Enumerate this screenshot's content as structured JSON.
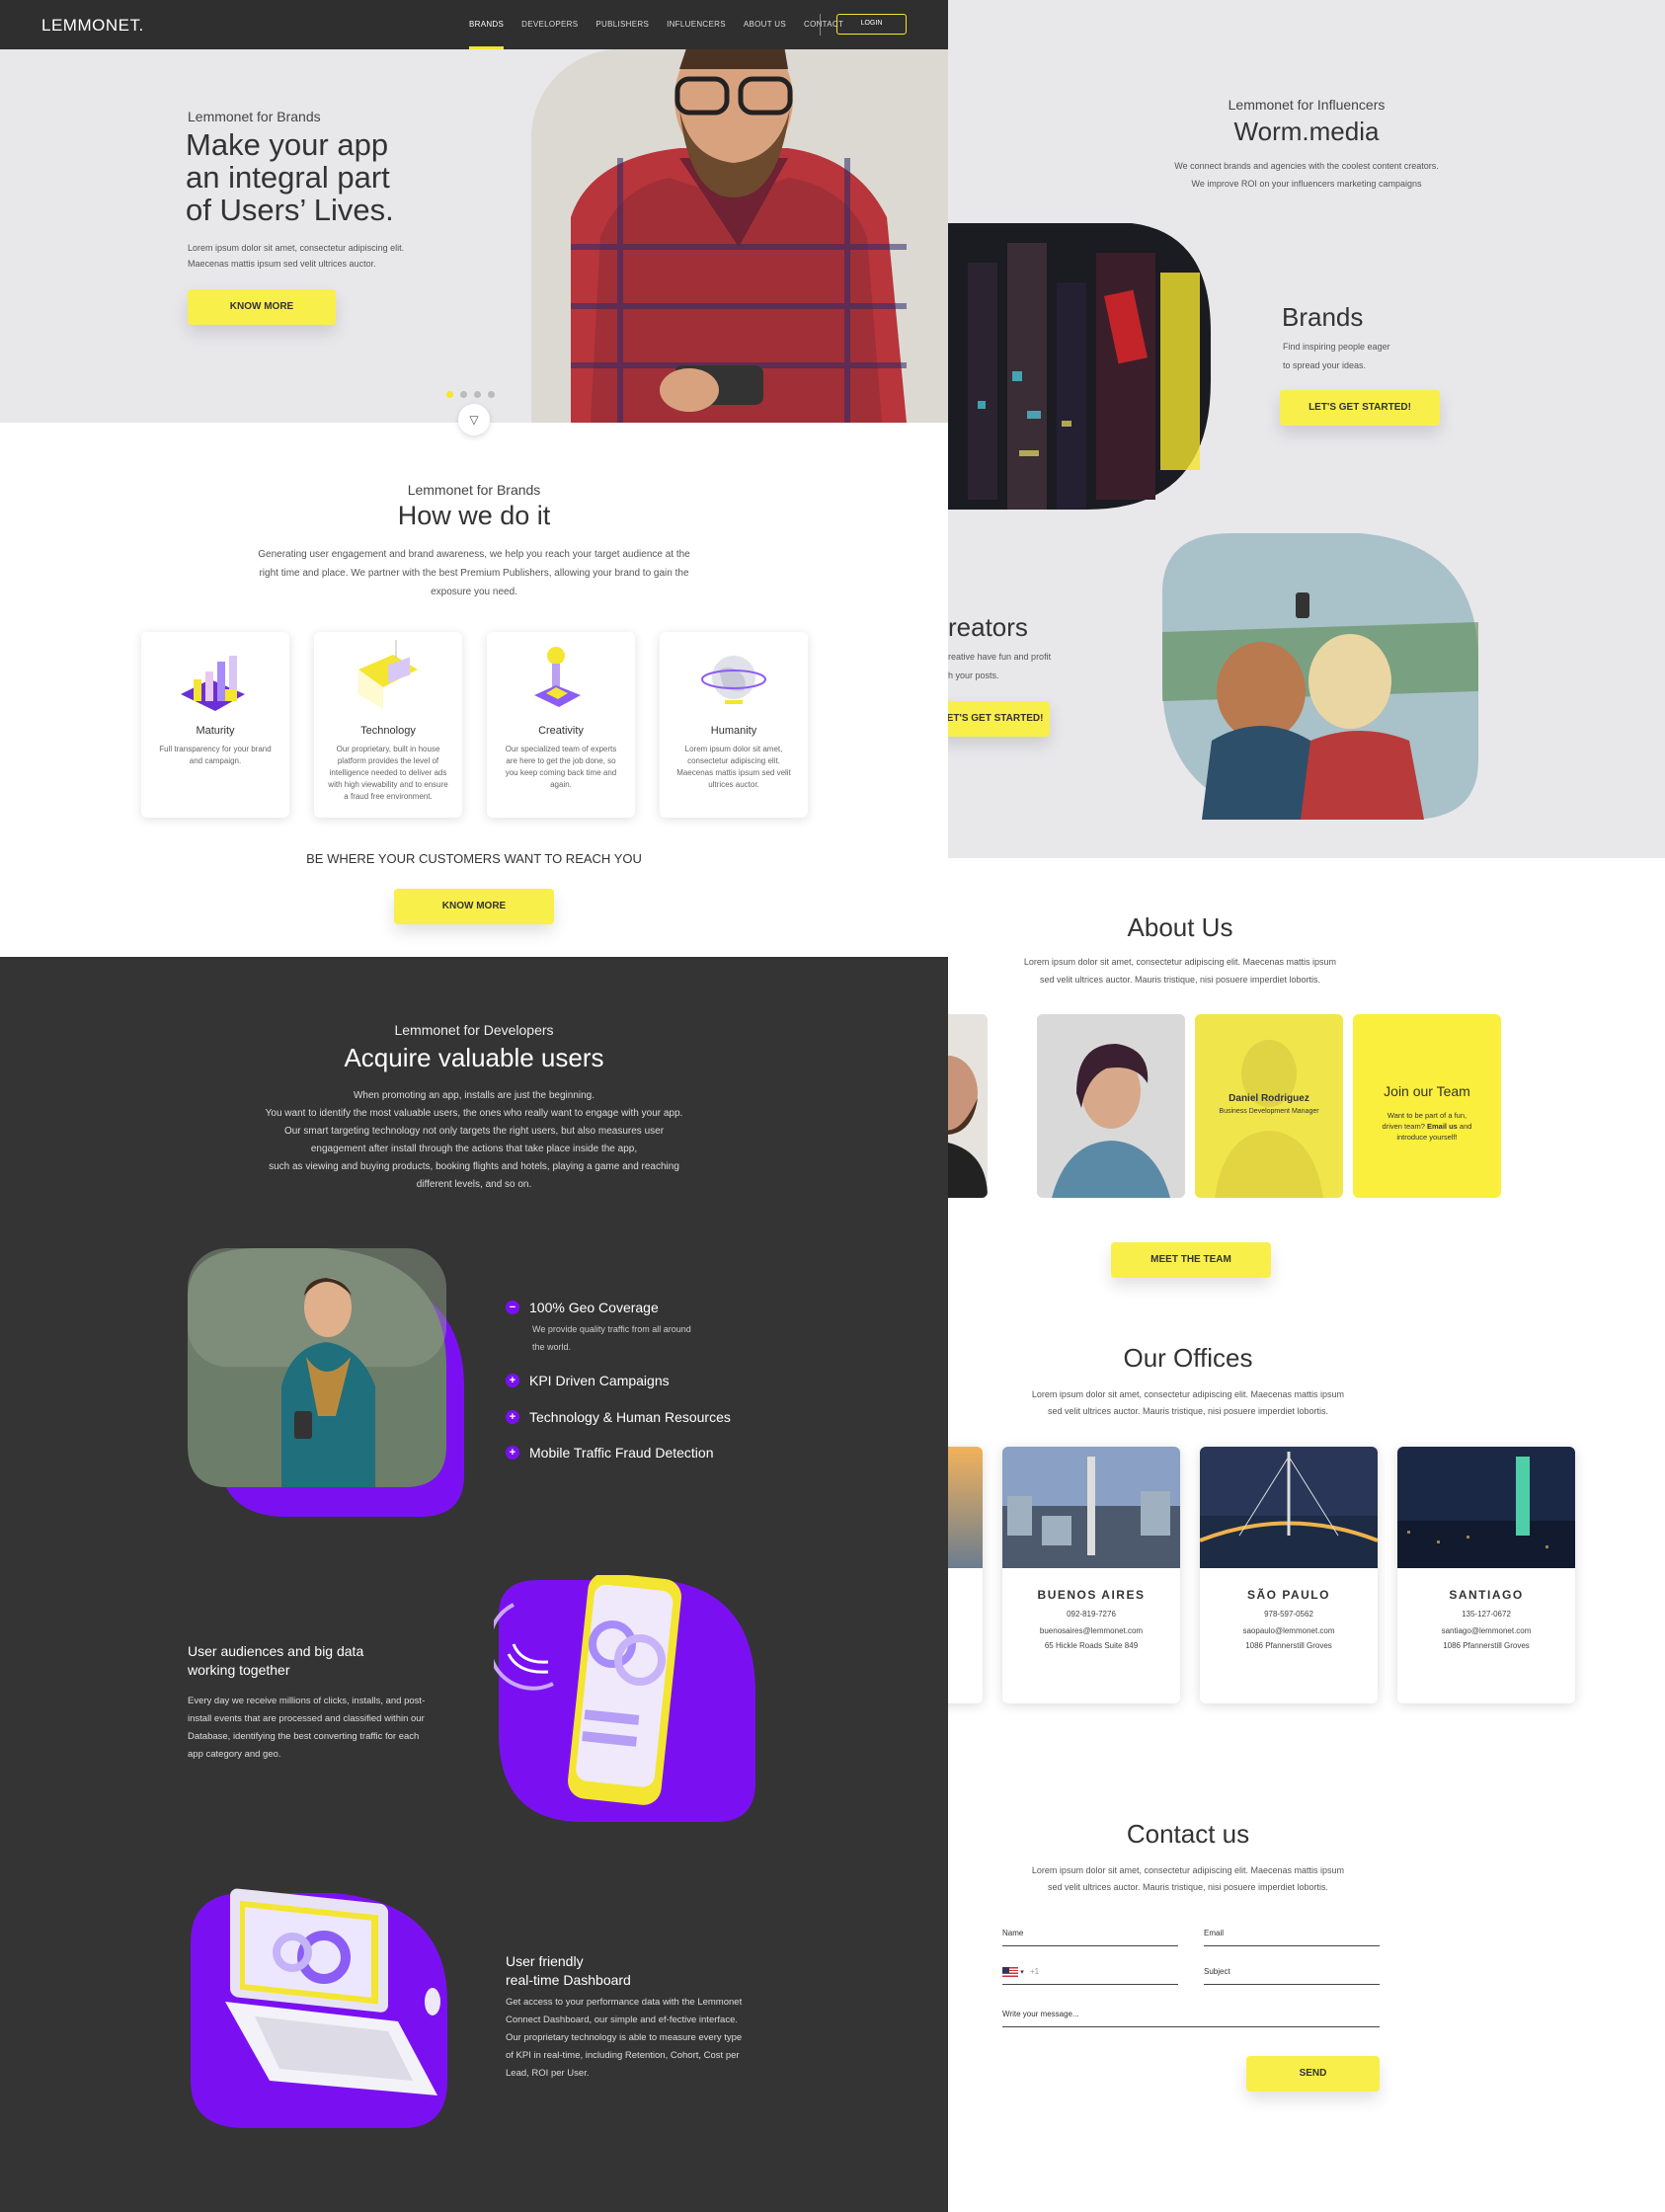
{
  "nav": {
    "logo": "LEMMONET.",
    "links": [
      "BRANDS",
      "DEVELOPERS",
      "PUBLISHERS",
      "INFLUENCERS",
      "ABOUT US",
      "CONTACT"
    ],
    "login": "LOGIN"
  },
  "hero": {
    "eyebrow": "Lemmonet for Brands",
    "title_1": "Make your app",
    "title_2": "an integral part",
    "title_3": "of Users’ Lives.",
    "desc_1": "Lorem ipsum dolor sit amet, consectetur adipiscing elit.",
    "desc_2": "Maecenas mattis ipsum sed velit ultrices auctor.",
    "cta": "KNOW MORE"
  },
  "how": {
    "eyebrow": "Lemmonet for Brands",
    "title": "How we do it",
    "desc_1": "Generating user engagement and brand awareness, we help you reach your target audience at the",
    "desc_2": "right time and place. We partner with the best Premium Publishers, allowing your brand to gain the",
    "desc_3": "exposure you need.",
    "cards": [
      {
        "title": "Maturity",
        "text": "Full transparency for your brand and campaign."
      },
      {
        "title": "Technology",
        "text": "Our proprietary, built in house platform provides the level of intelligence needed to deliver ads with high viewability and to ensure a fraud free environment."
      },
      {
        "title": "Creativity",
        "text": "Our specialized team of experts are here to get the job done, so you keep coming back time and again."
      },
      {
        "title": "Humanity",
        "text": "Lorem ipsum dolor sit amet, consectetur adipiscing elit. Maecenas mattis ipsum sed velit ultrices auctor."
      }
    ],
    "tagline": "BE WHERE YOUR CUSTOMERS WANT TO REACH YOU",
    "cta": "KNOW MORE"
  },
  "dev": {
    "eyebrow": "Lemmonet for Developers",
    "title": "Acquire valuable users",
    "lines": [
      "When promoting an app, installs are just the beginning.",
      "You want to identify the most valuable users, the ones who really want to engage with your app.",
      "Our smart targeting technology not only targets the right users, but also measures user",
      "engagement after install through the actions that take place inside the app,",
      "such as viewing and buying products, booking flights and hotels, playing a game and reaching",
      "different levels, and so on."
    ],
    "features": [
      {
        "icon": "minus-icon",
        "symbol": "−",
        "label": "100% Geo Coverage",
        "detail_1": "We provide quality traffic from all around",
        "detail_2": "the world."
      },
      {
        "icon": "plus-icon",
        "symbol": "+",
        "label": "KPI Driven Campaigns"
      },
      {
        "icon": "plus-icon",
        "symbol": "+",
        "label": "Technology & Human Resources"
      },
      {
        "icon": "plus-icon",
        "symbol": "+",
        "label": "Mobile Traffic Fraud Detection"
      }
    ],
    "bigdata_title_1": "User audiences and big data",
    "bigdata_title_2": "working together",
    "bigdata_lines": [
      "Every day we receive millions of clicks, installs, and post-",
      "install events that are processed and classified within our",
      "Database, identifying the best converting traffic for each",
      "app category and geo."
    ],
    "dash_title_1": "User friendly",
    "dash_title_2": "real-time Dashboard",
    "dash_lines": [
      "Get access to your performance data with the Lemmonet",
      "Connect Dashboard, our simple and ef-fective interface.",
      "Our proprietary technology is able to measure every type",
      "of KPI in real-time, including Retention, Cohort, Cost per",
      "Lead, ROI per User."
    ]
  },
  "influencers": {
    "eyebrow": "Lemmonet for Influencers",
    "title": "Worm.media",
    "desc_1": "We connect brands and agencies with the coolest content creators.",
    "desc_2": "We improve ROI on your influencers marketing campaigns",
    "brands_title": "Brands",
    "brands_desc_1": "Find inspiring people eager",
    "brands_desc_2": "to spread your ideas.",
    "brands_cta": "LET'S GET STARTED!",
    "creators_title": "reators",
    "creators_desc_1": "reative have fun and profit",
    "creators_desc_2": "h your posts.",
    "creators_cta": "LET'S GET STARTED!"
  },
  "about": {
    "title": "About Us",
    "desc_1": "Lorem ipsum dolor sit amet, consectetur adipiscing elit. Maecenas mattis ipsum",
    "desc_2": "sed velit ultrices auctor. Mauris tristique, nisi posuere imperdiet lobortis.",
    "member_name": "Daniel Rodriguez",
    "member_role": "Business Development Manager",
    "join_title": "Join our Team",
    "join_1": "Want to be part of a fun,",
    "join_2a": "driven team? ",
    "join_2b": "Email us",
    "join_2c": " and",
    "join_3": "introduce yourself!",
    "cta": "MEET THE TEAM"
  },
  "offices": {
    "title": "Our Offices",
    "desc_1": "Lorem ipsum dolor sit amet, consectetur adipiscing elit. Maecenas mattis ipsum",
    "desc_2": "sed velit ultrices auctor. Mauris tristique, nisi posuere imperdiet lobortis.",
    "list": [
      {
        "city": "BUENOS AIRES",
        "phone": "092-819-7276",
        "email": "buenosaires@lemmonet.com",
        "address": "65 Hickle Roads Suite 849"
      },
      {
        "city": "SÃO PAULO",
        "phone": "978-597-0562",
        "email": "saopaulo@lemmonet.com",
        "address": "1086 Pfannerstill Groves"
      },
      {
        "city": "SANTIAGO",
        "phone": "135-127-0672",
        "email": "santiago@lemmonet.com",
        "address": "1086 Pfannerstill Groves"
      }
    ]
  },
  "contact": {
    "title": "Contact us",
    "desc_1": "Lorem ipsum dolor sit amet, consectetur adipiscing elit. Maecenas mattis ipsum",
    "desc_2": "sed velit ultrices auctor. Mauris tristique, nisi posuere imperdiet lobortis.",
    "name_label": "Name",
    "email_label": "Email",
    "phone_code": "+1",
    "subject_label": "Subject",
    "message_label": "Write your message...",
    "send": "SEND"
  },
  "colors": {
    "accent": "#f9ef4b",
    "purple": "#7a10f2",
    "dark": "#343434"
  }
}
